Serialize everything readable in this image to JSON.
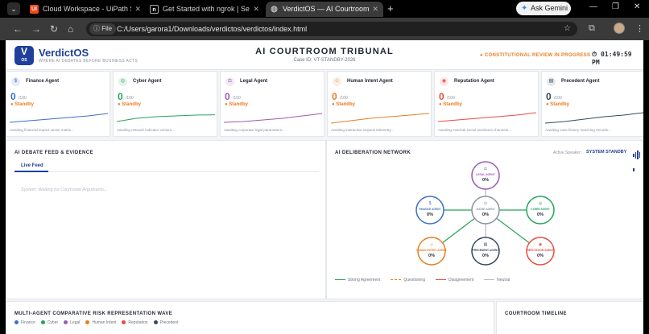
{
  "browser": {
    "tabs": [
      {
        "title": "Cloud Workspace - UiPath Studio",
        "favicon": "Ui",
        "color": "#fa4616"
      },
      {
        "title": "Get Started with ngrok | Setup",
        "favicon": "n",
        "color": "#000000"
      },
      {
        "title": "VerdictOS — AI Courtroom Tribunal",
        "favicon": "globe-icon",
        "color": "#888888"
      }
    ],
    "ask_gemini": "Ask Gemini",
    "file_chip": "File",
    "url": "C:/Users/garora1/Downloads/verdictos/verdictos/index.html"
  },
  "header": {
    "logo_letter": "V",
    "logo_sub": "OS",
    "brand": "VerdictOS",
    "tagline": "WHERE AI DEBATES BEFORE BUSINESS ACTS",
    "title": "AI COURTROOM TRIBUNAL",
    "case_id": "Case ID: VT-STANDBY-2026",
    "review_status": "● CONSTITUTIONAL REVIEW IN PROGRESS",
    "clock": "⏱ 01:49:59 PM"
  },
  "agents": [
    {
      "name": "Finance Agent",
      "icon": "$",
      "score": "0",
      "of": "/100",
      "status": "● Standby",
      "desc": "Awaiting financial impact vector matrix...",
      "color": "#3b6fc9",
      "spark": [
        0.15,
        0.25,
        0.35,
        0.45,
        0.55,
        0.7
      ]
    },
    {
      "name": "Cyber Agent",
      "icon": "◎",
      "score": "0",
      "of": "/100",
      "status": "● Standby",
      "desc": "Awaiting network indicator vectors...",
      "color": "#27a35a",
      "spark": [
        0.2,
        0.4,
        0.5,
        0.55,
        0.6,
        0.62
      ]
    },
    {
      "name": "Legal Agent",
      "icon": "⚖",
      "score": "0",
      "of": "/100",
      "status": "● Standby",
      "desc": "Awaiting corporate legal parameters...",
      "color": "#9b59b6",
      "spark": [
        0.15,
        0.2,
        0.3,
        0.4,
        0.55,
        0.7
      ]
    },
    {
      "name": "Human Intent Agent",
      "icon": "☺",
      "score": "0",
      "of": "/100",
      "status": "● Standby",
      "desc": "Awaiting interactive request telemetry...",
      "color": "#e67e22",
      "spark": [
        0.1,
        0.25,
        0.4,
        0.5,
        0.6,
        0.7
      ]
    },
    {
      "name": "Reputation Agent",
      "icon": "◉",
      "score": "0",
      "of": "/100",
      "status": "● Standby",
      "desc": "Awaiting external social sentiment channels...",
      "color": "#e74c3c",
      "spark": [
        0.2,
        0.3,
        0.4,
        0.5,
        0.6,
        0.75
      ]
    },
    {
      "name": "Precedent Agent",
      "icon": "▤",
      "score": "0",
      "of": "/100",
      "status": "● Standby",
      "desc": "Awaiting case history matching records...",
      "color": "#34495e",
      "spark": [
        0.1,
        0.2,
        0.35,
        0.5,
        0.6,
        0.75
      ]
    }
  ],
  "feed": {
    "title": "AI DEBATE FEED & EVIDENCE",
    "tab": "Live Feed",
    "placeholder": "System: Waiting for Courtroom Arguments..."
  },
  "network": {
    "title": "AI DELIBERATION NETWORK",
    "active_label": "Active Speaker:",
    "active_value": "SYSTEM STANDBY",
    "nodes": [
      {
        "label": "LEGAL AGENT",
        "pct": "0%",
        "color": "#9b59b6",
        "icon": "⚖"
      },
      {
        "label": "FINANCE AGENT",
        "pct": "0%",
        "color": "#3b6fc9",
        "icon": "$"
      },
      {
        "label": "JUDGE AGENT",
        "pct": "0%",
        "color": "#8a93a0",
        "icon": "⚖"
      },
      {
        "label": "CYBER AGENT",
        "pct": "0%",
        "color": "#27a35a",
        "icon": "◎"
      },
      {
        "label": "HUMAN INTENT AGENT",
        "pct": "0%",
        "color": "#e67e22",
        "icon": "☺"
      },
      {
        "label": "PRECEDENT AGENT",
        "pct": "0%",
        "color": "#34495e",
        "icon": "▤"
      },
      {
        "label": "REPUTATION AGENT",
        "pct": "0%",
        "color": "#e74c3c",
        "icon": "◉"
      }
    ],
    "legend": [
      {
        "label": "Strong Agreement",
        "color": "#27a35a"
      },
      {
        "label": "Questioning",
        "color": "#e67e22"
      },
      {
        "label": "Disagreement",
        "color": "#e74c3c"
      },
      {
        "label": "Neutral",
        "color": "#b4bac3"
      }
    ]
  },
  "risk": {
    "title": "MULTI-AGENT COMPARATIVE RISK REPRESENTATION WAVE",
    "legend": [
      {
        "label": "Finance",
        "color": "#3b6fc9"
      },
      {
        "label": "Cyber",
        "color": "#27a35a"
      },
      {
        "label": "Legal",
        "color": "#9b59b6"
      },
      {
        "label": "Human Intent",
        "color": "#e67e22"
      },
      {
        "label": "Reputation",
        "color": "#e74c3c"
      },
      {
        "label": "Precedent",
        "color": "#34495e"
      }
    ]
  },
  "timeline": {
    "title": "COURTROOM TIMELINE"
  }
}
